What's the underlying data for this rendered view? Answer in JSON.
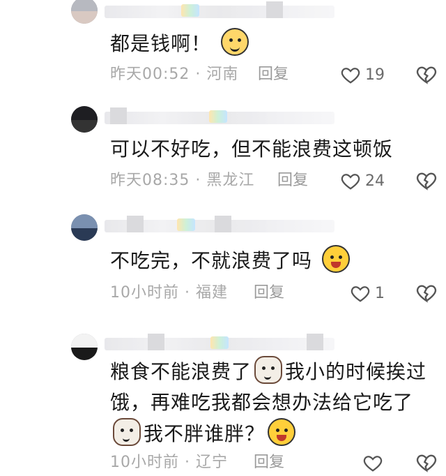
{
  "comments": [
    {
      "text": "都是钱啊！",
      "emojis": [
        "smile-tear-emoji"
      ],
      "time": "昨天00:52 · 河南",
      "reply": "回复",
      "likes": "19"
    },
    {
      "text": "可以不好吃，但不能浪费这顿饭",
      "emojis": [],
      "time": "昨天08:35 · 黑龙江",
      "reply": "回复",
      "likes": "24"
    },
    {
      "text": "不吃完，不就浪费了吗",
      "emojis": [
        "laughing-tears-emoji"
      ],
      "time": "10小时前 · 福建",
      "reply": "回复",
      "likes": "1"
    },
    {
      "text_parts": [
        "粮食不能浪费了",
        "我小的时候挨过饿，再难吃我都会想办法给它吃了",
        "我不胖谁胖？"
      ],
      "emojis": [
        "cat-emoji",
        "cat-emoji",
        "laughing-tears-emoji"
      ],
      "time": "10小时前 · 辽宁",
      "reply": "回复",
      "likes": ""
    }
  ],
  "icons": {
    "like": "heart-outline-icon",
    "dislike": "broken-heart-icon"
  },
  "colors": {
    "text": "#1a1a1a",
    "meta": "#a8a8a8",
    "icon": "#6b6b6b"
  }
}
